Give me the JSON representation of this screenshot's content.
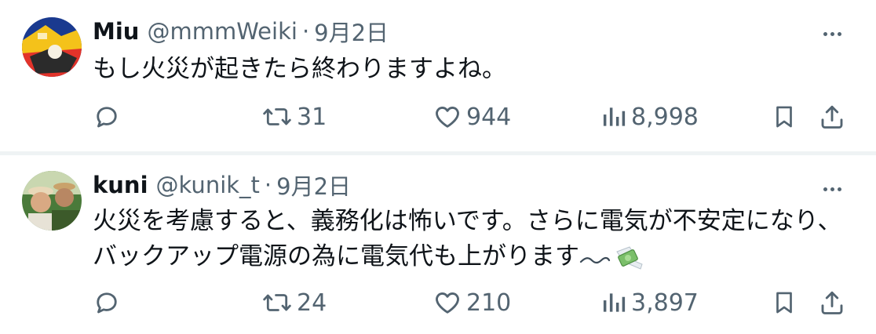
{
  "tweets": [
    {
      "display_name": "Miu",
      "handle": "@mmmWeiki",
      "separator": "·",
      "time": "9月2日",
      "text_lines": [
        "もし火災が起きたら終わりますよね。"
      ],
      "reply_count": "",
      "retweet_count": "31",
      "like_count": "944",
      "view_count": "8,998",
      "avatar_colors": [
        "#1a3a8f",
        "#e2332a",
        "#f4c21a",
        "#2b2b2b"
      ]
    },
    {
      "display_name": "kuni",
      "handle": "@kunik_t",
      "separator": "·",
      "time": "9月2日",
      "text_lines": [
        "火災を考慮すると、義務化は怖いです。さらに電気が不安定になり、",
        "バックアップ電源の為に電気代も上がります"
      ],
      "text_emoji": [
        "wavy-dash-emoji",
        "money-with-wings-emoji"
      ],
      "reply_count": "",
      "retweet_count": "24",
      "like_count": "210",
      "view_count": "3,897",
      "avatar_colors": [
        "#c9a26b",
        "#4a7a3a",
        "#e8d8b8",
        "#3c5a2a"
      ]
    }
  ],
  "icons": {
    "reply": "reply-icon",
    "retweet": "retweet-icon",
    "like": "heart-icon",
    "views": "views-icon",
    "bookmark": "bookmark-icon",
    "share": "share-icon",
    "more": "more-icon"
  },
  "colors": {
    "text_primary": "#0f1419",
    "text_secondary": "#536471",
    "separator": "#eff3f4",
    "background": "#ffffff"
  }
}
